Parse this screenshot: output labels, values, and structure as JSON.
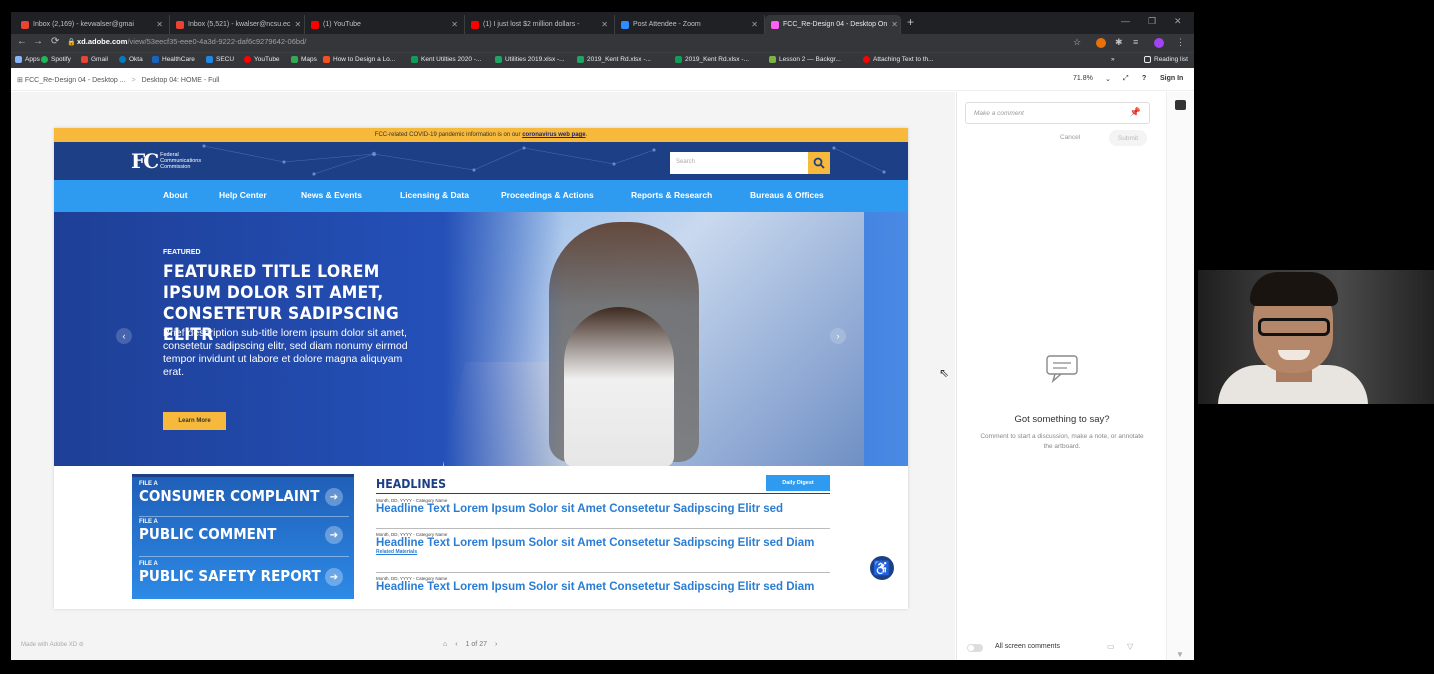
{
  "browser": {
    "tabs": [
      {
        "label": "Inbox (2,169) - kevwalser@gmai",
        "color": "#ea4335"
      },
      {
        "label": "Inbox (5,521) - kwalser@ncsu.ec",
        "color": "#ea4335"
      },
      {
        "label": "(1) YouTube",
        "color": "#ff0000"
      },
      {
        "label": "(1) I just lost $2 million dollars -",
        "color": "#ff0000"
      },
      {
        "label": "Post Attendee - Zoom",
        "color": "#2d8cff"
      },
      {
        "label": "FCC_Re-Design 04 - Desktop On",
        "color": "#470137"
      }
    ],
    "url_host": "xd.adobe.com",
    "url_path": "/view/53eecf35-eee0-4a3d-9222-daf6c9279642-06bd/",
    "bookmarks": [
      "Apps",
      "Spotify",
      "Gmail",
      "Okta",
      "HealthCare",
      "SECU",
      "YouTube",
      "Maps",
      "How to Design a Lo...",
      "Kent Utilties 2020 -...",
      "Utilities 2019.xlsx -...",
      "2019_Kent Rd.xlsx -...",
      "2019_Kent Rd.xlsx -...",
      "Lesson 2 — Backgr...",
      "Attaching Text to th..."
    ],
    "reading_list": "Reading list",
    "bookmarks_more": "»"
  },
  "xd": {
    "breadcrumb_doc": "FCC_Re-Design 04 - Desktop ...",
    "breadcrumb_sep": ">",
    "breadcrumb_page": "Desktop 04: HOME - Full",
    "zoom": "71.8%",
    "sign_in": "Sign In",
    "made_with": "Made with Adobe XD",
    "pager": "1 of 27"
  },
  "fcc": {
    "covid_text": "FCC-related COVID-19 pandemic information is on our ",
    "covid_link": "coronavirus web page",
    "covid_end": ".",
    "logo_mark": "FC",
    "logo_name": [
      "Federal",
      "Communications",
      "Commission"
    ],
    "search_placeholder": "Search",
    "nav": [
      "About",
      "Help Center",
      "News & Events",
      "Licensing & Data",
      "Proceedings & Actions",
      "Reports & Research",
      "Bureaus & Offices"
    ],
    "featured_label": "FEATURED",
    "featured_title": "FEATURED TITLE LOREM IPSUM DOLOR SIT AMET, CONSETETUR SADIPSCING ELITR",
    "featured_desc": "Brief description sub-title lorem ipsum dolor sit amet, consetetur sadipscing elitr, sed diam nonumy eirmod tempor invidunt ut labore et dolore magna aliquyam erat.",
    "learn_more": "Learn More",
    "file_items": [
      {
        "small": "FILE A",
        "big": "CONSUMER COMPLAINT"
      },
      {
        "small": "FILE A",
        "big": "PUBLIC COMMENT"
      },
      {
        "small": "FILE A",
        "big": "PUBLIC SAFETY REPORT"
      }
    ],
    "headlines_title": "HEADLINES",
    "daily_digest": "Daily Digest",
    "headlines": [
      {
        "meta": "Month, DD, YYYY - Category Name",
        "text": "Headline Text Lorem Ipsum Solor sit Amet Consetetur Sadipscing Elitr sed",
        "related": ""
      },
      {
        "meta": "Month, DD, YYYY - Category Name",
        "text": "Headline Text Lorem Ipsum Solor sit Amet Consetetur Sadipscing Elitr sed Diam",
        "related": "Related Materials"
      },
      {
        "meta": "Month, DD, YYYY - Category Name",
        "text": "Headline Text Lorem Ipsum Solor sit Amet Consetetur Sadipscing Elitr sed Diam",
        "related": ""
      }
    ]
  },
  "comments": {
    "placeholder": "Make a comment",
    "cancel": "Cancel",
    "submit": "Submit",
    "empty_title": "Got something to say?",
    "empty_desc": "Comment to start a discussion, make a note, or annotate the artboard.",
    "all_screen": "All screen comments"
  }
}
